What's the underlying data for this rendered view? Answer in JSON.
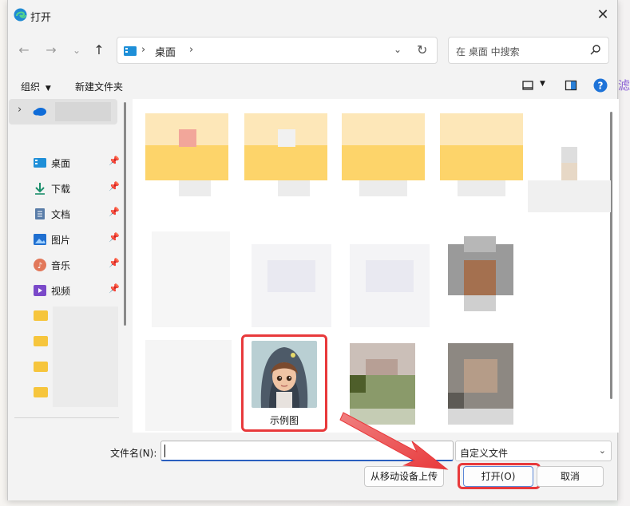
{
  "window": {
    "title": "打开"
  },
  "address_bar": {
    "location": "桌面"
  },
  "search": {
    "placeholder": "在 桌面 中搜索"
  },
  "toolbar": {
    "organize_label": "组织",
    "new_folder_label": "新建文件夹"
  },
  "sidebar": {
    "items": [
      {
        "label": "桌面",
        "icon": "desktop-icon"
      },
      {
        "label": "下载",
        "icon": "download-icon"
      },
      {
        "label": "文档",
        "icon": "document-icon"
      },
      {
        "label": "图片",
        "icon": "picture-icon"
      },
      {
        "label": "音乐",
        "icon": "music-icon"
      },
      {
        "label": "视频",
        "icon": "video-icon"
      }
    ]
  },
  "files": {
    "selected_file_name": "示例图"
  },
  "bottom_bar": {
    "filename_label": "文件名(N):",
    "filename_value": "",
    "file_type": "自定义文件",
    "upload_label": "从移动设备上传",
    "open_label": "打开(O)",
    "cancel_label": "取消"
  },
  "background": {
    "purple_text": "滤"
  },
  "colors": {
    "highlight": "#e8393b",
    "accent": "#2a5fbf",
    "folder": "#f6c53c"
  }
}
